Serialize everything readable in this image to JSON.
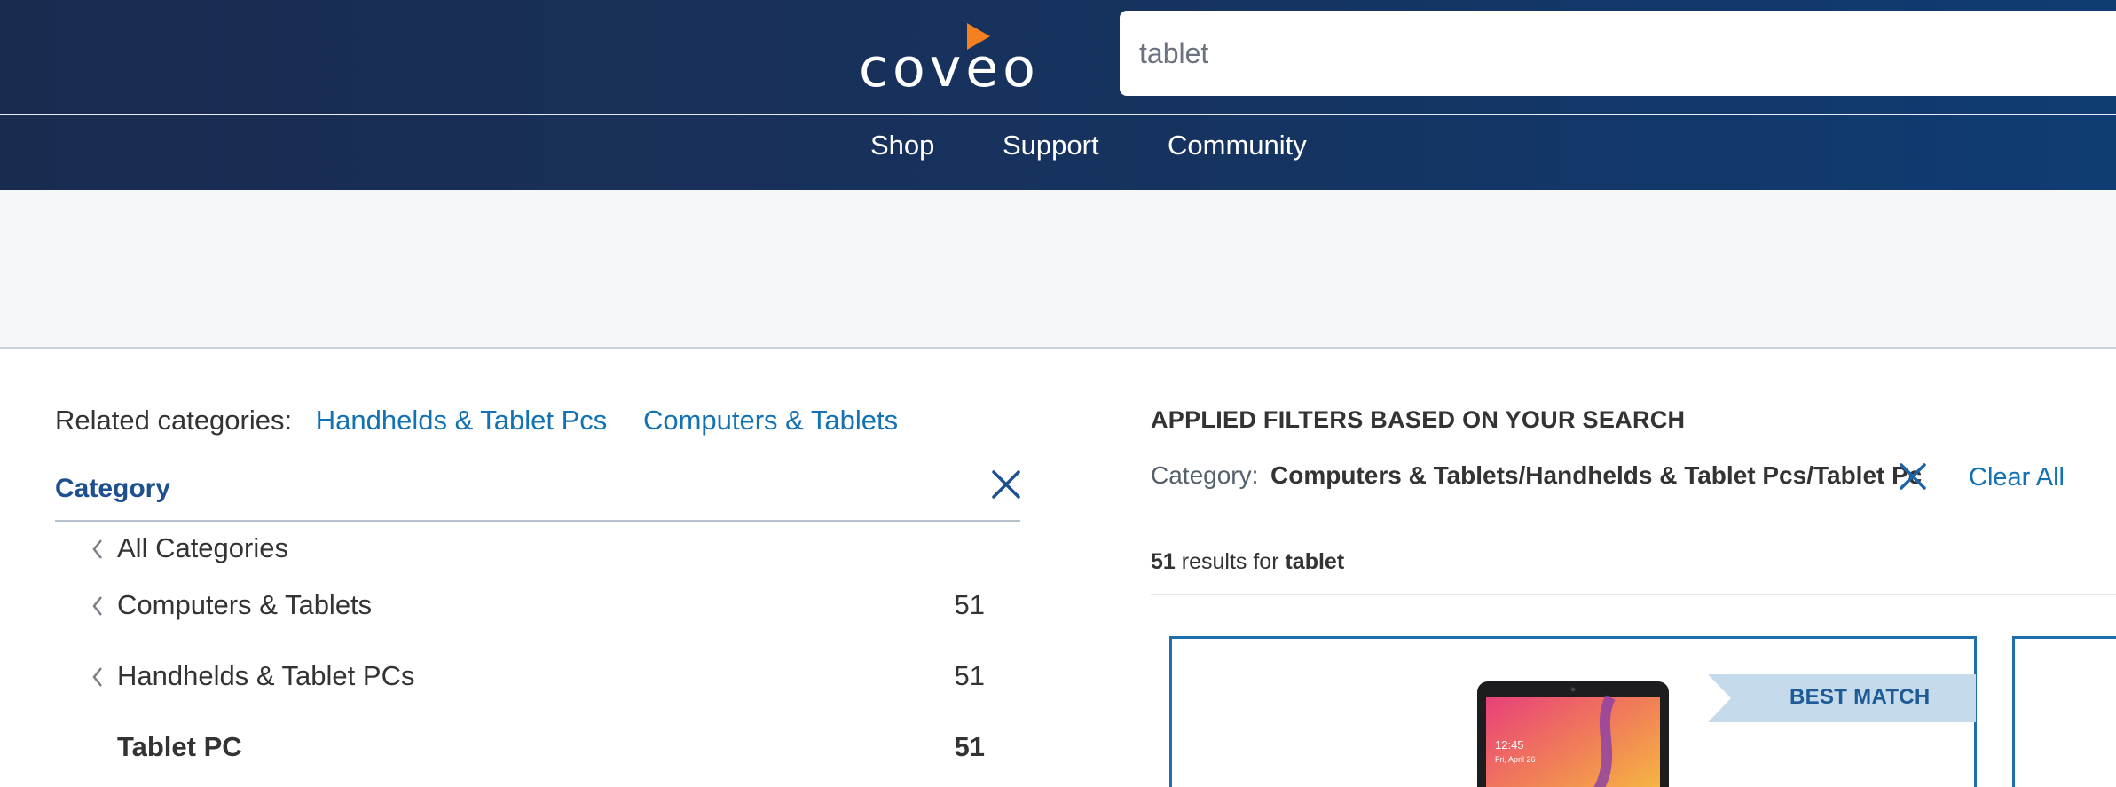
{
  "header": {
    "logo_text": "coveo",
    "search": {
      "value": "tablet",
      "placeholder": ""
    },
    "nav": [
      "Shop",
      "Support",
      "Community"
    ]
  },
  "related_categories": {
    "label": "Related categories:",
    "links": [
      "Handhelds & Tablet Pcs",
      "Computers & Tablets"
    ]
  },
  "facet": {
    "title": "Category",
    "items": [
      {
        "label": "All Categories",
        "count": ""
      },
      {
        "label": "Computers & Tablets",
        "count": "51"
      },
      {
        "label": "Handhelds & Tablet PCs",
        "count": "51"
      },
      {
        "label": "Tablet PC",
        "count": "51",
        "selected": true
      }
    ]
  },
  "applied_filters": {
    "title": "APPLIED FILTERS BASED ON YOUR SEARCH",
    "label": "Category:",
    "value": "Computers & Tablets/Handhelds & Tablet Pcs/Tablet Pc",
    "clear_all": "Clear All"
  },
  "results": {
    "count": "51",
    "for_text": "results for",
    "query": "tablet"
  },
  "products": [
    {
      "badge": "BEST MATCH",
      "device_time": "12:45",
      "device_date": "Fri, April 26"
    }
  ],
  "colors": {
    "header_dark": "#1a2b50",
    "header_light": "#0f3c73",
    "logo_accent": "#f58020",
    "link": "#1372b4",
    "card_border": "#1f6fae",
    "badge_bg": "#c5dbec"
  }
}
